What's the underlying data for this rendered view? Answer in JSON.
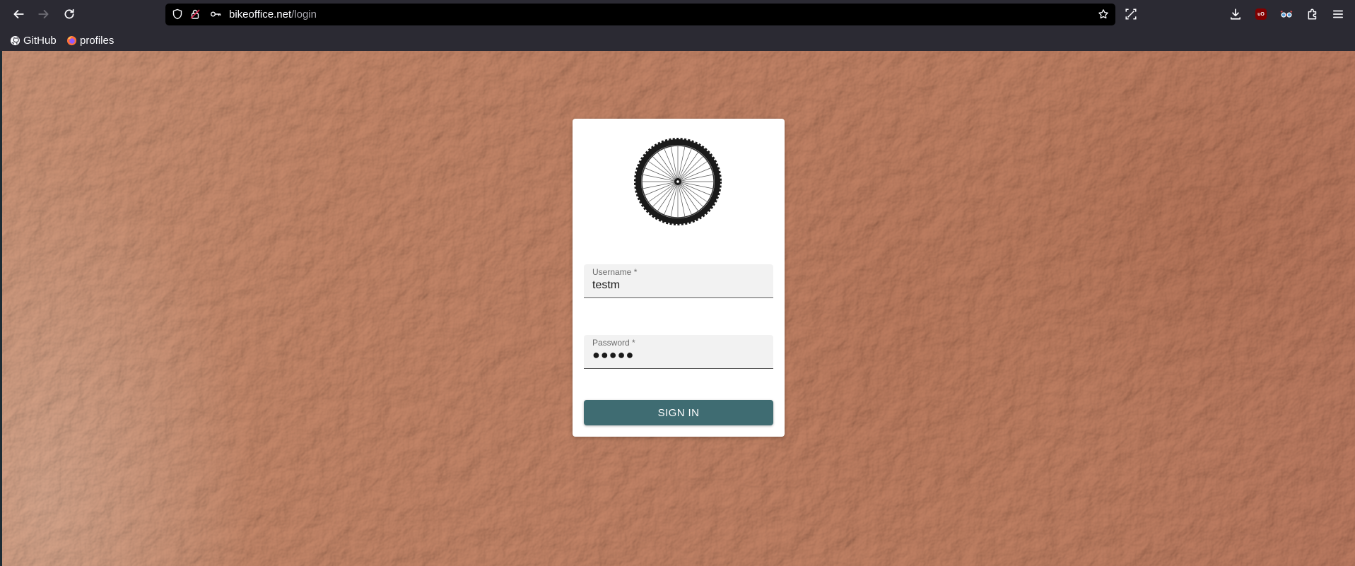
{
  "browser": {
    "url_domain": "bikeoffice.net",
    "url_path": "/login",
    "bookmarks": [
      {
        "label": "GitHub",
        "icon": "github-icon"
      },
      {
        "label": "profiles",
        "icon": "firefox-icon"
      }
    ],
    "extension_badge": "uO"
  },
  "login": {
    "logo_icon": "bicycle-wheel-icon",
    "username": {
      "label": "Username *",
      "value": "testm"
    },
    "password": {
      "label": "Password *",
      "value": "●●●●●"
    },
    "signin_label": "SIGN IN"
  },
  "colors": {
    "button": "#3f6c72",
    "card": "#ffffff",
    "background": "#c48467"
  }
}
